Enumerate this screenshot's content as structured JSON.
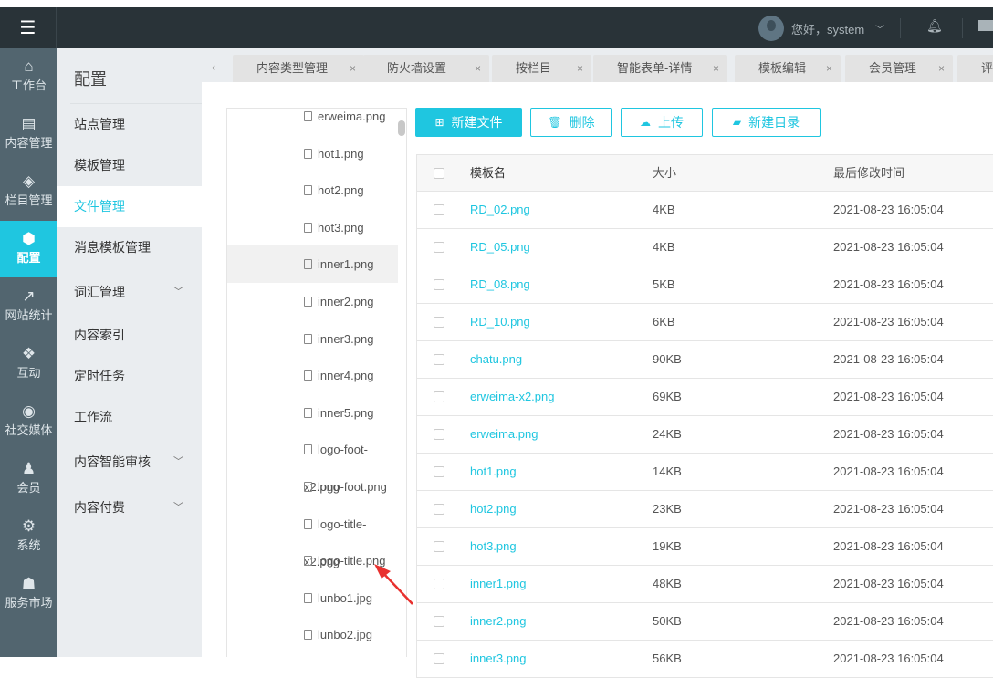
{
  "header": {
    "greeting": "您好，system"
  },
  "rail": [
    {
      "label": "工作台",
      "icon": "⌂"
    },
    {
      "label": "内容管理",
      "icon": "▤"
    },
    {
      "label": "栏目管理",
      "icon": "◈"
    },
    {
      "label": "配置",
      "icon": "⬢"
    },
    {
      "label": "网站统计",
      "icon": "↗"
    },
    {
      "label": "互动",
      "icon": "❖"
    },
    {
      "label": "社交媒体",
      "icon": "◉"
    },
    {
      "label": "会员",
      "icon": "♟"
    },
    {
      "label": "系统",
      "icon": "⚙"
    },
    {
      "label": "服务市场",
      "icon": "☗"
    }
  ],
  "submenu": {
    "title": "配置",
    "items": [
      {
        "label": "站点管理"
      },
      {
        "label": "模板管理"
      },
      {
        "label": "文件管理"
      },
      {
        "label": "消息模板管理"
      },
      {
        "label": "词汇管理"
      },
      {
        "label": "内容索引"
      },
      {
        "label": "定时任务"
      },
      {
        "label": "工作流"
      },
      {
        "label": "内容智能审核"
      },
      {
        "label": "内容付费"
      }
    ]
  },
  "tabs": [
    {
      "label": "内容类型管理"
    },
    {
      "label": "防火墙设置"
    },
    {
      "label": "按栏目"
    },
    {
      "label": "智能表单-详情"
    },
    {
      "label": "模板编辑"
    },
    {
      "label": "会员管理"
    },
    {
      "label": "评"
    }
  ],
  "tree": [
    "erweima.png",
    "hot1.png",
    "hot2.png",
    "hot3.png",
    "inner1.png",
    "inner2.png",
    "inner3.png",
    "inner4.png",
    "inner5.png",
    "logo-foot-x2.png",
    "logo-foot.png",
    "logo-title-x2.png",
    "logo-title.png",
    "lunbo1.jpg",
    "lunbo2.jpg"
  ],
  "toolbar": {
    "new_file": "新建文件",
    "delete": "删除",
    "upload": "上传",
    "new_dir": "新建目录"
  },
  "table": {
    "headers": {
      "name": "模板名",
      "size": "大小",
      "modified": "最后修改时间"
    },
    "rows": [
      {
        "name": "RD_02.png",
        "size": "4KB",
        "modified": "2021-08-23 16:05:04"
      },
      {
        "name": "RD_05.png",
        "size": "4KB",
        "modified": "2021-08-23 16:05:04"
      },
      {
        "name": "RD_08.png",
        "size": "5KB",
        "modified": "2021-08-23 16:05:04"
      },
      {
        "name": "RD_10.png",
        "size": "6KB",
        "modified": "2021-08-23 16:05:04"
      },
      {
        "name": "chatu.png",
        "size": "90KB",
        "modified": "2021-08-23 16:05:04"
      },
      {
        "name": "erweima-x2.png",
        "size": "69KB",
        "modified": "2021-08-23 16:05:04"
      },
      {
        "name": "erweima.png",
        "size": "24KB",
        "modified": "2021-08-23 16:05:04"
      },
      {
        "name": "hot1.png",
        "size": "14KB",
        "modified": "2021-08-23 16:05:04"
      },
      {
        "name": "hot2.png",
        "size": "23KB",
        "modified": "2021-08-23 16:05:04"
      },
      {
        "name": "hot3.png",
        "size": "19KB",
        "modified": "2021-08-23 16:05:04"
      },
      {
        "name": "inner1.png",
        "size": "48KB",
        "modified": "2021-08-23 16:05:04"
      },
      {
        "name": "inner2.png",
        "size": "50KB",
        "modified": "2021-08-23 16:05:04"
      },
      {
        "name": "inner3.png",
        "size": "56KB",
        "modified": "2021-08-23 16:05:04"
      }
    ]
  },
  "colors": {
    "accent": "#1fc6e0",
    "header": "#293338",
    "rail": "#52656f",
    "arrow": "#e8312f"
  }
}
